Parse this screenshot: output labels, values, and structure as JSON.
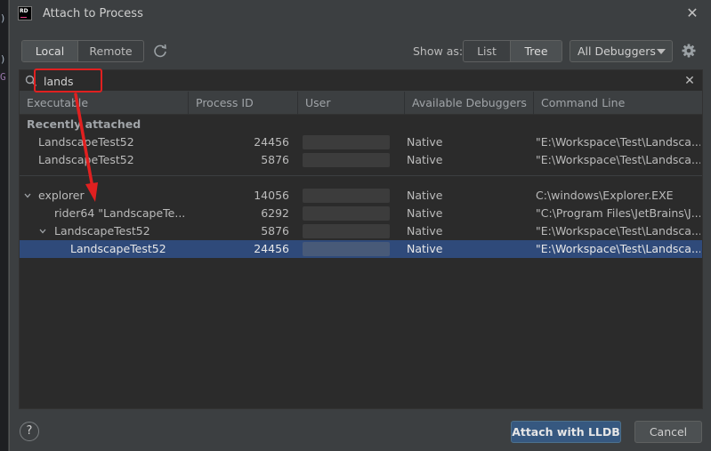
{
  "dialog": {
    "app_icon_text": "RD",
    "title": "Attach to Process"
  },
  "toolbar": {
    "host_toggle": [
      "Local",
      "Remote"
    ],
    "host_selected": "Local",
    "show_as_label": "Show as:",
    "view_toggle": [
      "List",
      "Tree"
    ],
    "view_selected": "Tree",
    "debugger_filter": "All Debuggers"
  },
  "search": {
    "value": "lands"
  },
  "table": {
    "columns": [
      "Executable",
      "Process ID",
      "User",
      "Available Debuggers",
      "Command Line"
    ],
    "recent_group_label": "Recently attached",
    "recent": [
      {
        "executable": "LandscapeTest52",
        "pid": "24456",
        "user": "",
        "debuggers": "Native",
        "command": "\"E:\\Workspace\\Test\\Landsca..."
      },
      {
        "executable": "LandscapeTest52",
        "pid": "5876",
        "user": "",
        "debuggers": "Native",
        "command": "\"E:\\Workspace\\Test\\Landsca..."
      }
    ],
    "tree": [
      {
        "executable": "explorer",
        "pid": "14056",
        "user": "",
        "debuggers": "Native",
        "command": "C:\\windows\\Explorer.EXE",
        "level": 0,
        "expanded": true
      },
      {
        "executable": "rider64 \"LandscapeTe...",
        "pid": "6292",
        "user": "",
        "debuggers": "Native",
        "command": "\"C:\\Program Files\\JetBrains\\J...",
        "level": 1,
        "expanded": null
      },
      {
        "executable": "LandscapeTest52",
        "pid": "5876",
        "user": "",
        "debuggers": "Native",
        "command": "\"E:\\Workspace\\Test\\Landsca...",
        "level": 1,
        "expanded": true
      },
      {
        "executable": "LandscapeTest52",
        "pid": "24456",
        "user": "",
        "debuggers": "Native",
        "command": "\"E:\\Workspace\\Test\\Landsca...",
        "level": 2,
        "expanded": null,
        "selected": true
      }
    ]
  },
  "footer": {
    "help_label": "?",
    "attach_label": "Attach with LLDB",
    "cancel_label": "Cancel"
  },
  "colors": {
    "annotation": "#e02020",
    "selection": "#2f4a7a",
    "primary_button": "#365880"
  }
}
